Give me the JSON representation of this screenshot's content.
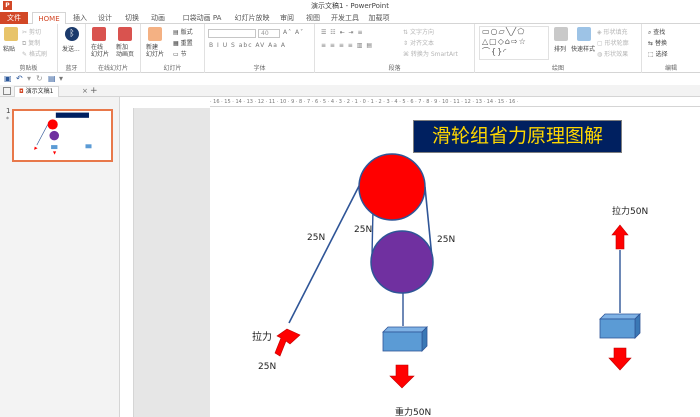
{
  "window": {
    "title": "演示文稿1 - PowerPoint",
    "app_logo": "P"
  },
  "tabs": [
    {
      "label": "文件"
    },
    {
      "label": "HOME"
    },
    {
      "label": "插入"
    },
    {
      "label": "设计"
    },
    {
      "label": "切换"
    },
    {
      "label": "动画"
    },
    {
      "label": "口袋动画 PA"
    },
    {
      "label": "幻灯片放映"
    },
    {
      "label": "审阅"
    },
    {
      "label": "视图"
    },
    {
      "label": "开发工具"
    },
    {
      "label": "加载项"
    }
  ],
  "ribbon": {
    "clipboard": {
      "paste": "粘贴",
      "cut": "剪切",
      "copy": "复制",
      "format_painter": "格式刷",
      "group_label": "剪贴板"
    },
    "bluetooth": {
      "send": "发送...",
      "group_label": "蓝牙"
    },
    "online": {
      "present_online": "在线\n幻灯片",
      "new_slide_from": "新加\n动画页",
      "group_label": "在线幻灯片"
    },
    "slides": {
      "new_slide": "新建\n幻灯片",
      "layout": "版式",
      "reset": "重置",
      "section": "节",
      "group_label": "幻灯片"
    },
    "font": {
      "font_name": "",
      "font_size": "40",
      "group_label": "字体"
    },
    "paragraph": {
      "text_direction": "文字方向",
      "align_text": "对齐文本",
      "convert_smartart": "转换为 SmartArt",
      "group_label": "段落"
    },
    "drawing": {
      "arrange": "排列",
      "quick_styles": "快速样式",
      "shape_fill": "形状填充",
      "shape_outline": "形状轮廓",
      "shape_effects": "形状效果",
      "group_label": "绘图"
    },
    "editing": {
      "find": "查找",
      "replace": "替换",
      "select": "选择",
      "group_label": "编辑"
    }
  },
  "doc_tab": {
    "name": "演示文稿1",
    "close": "×",
    "add": "+"
  },
  "thumbnails": [
    {
      "number": "1",
      "star": "*"
    }
  ],
  "ruler": {
    "top_marks": "· 16 · 15 · 14 · 13 · 12 · 11 · 10 · 9 · 8 · 7 · 6 · 5 · 4 · 3 · 2 · 1 · 0 · 1 · 2 · 3 · 4 · 5 · 6 · 7 · 8 · 9 · 10 · 11 · 12 · 13 · 14 · 15 · 16 ·"
  },
  "slide": {
    "title": "滑轮组省力原理图解",
    "labels": {
      "rope_left": "25N",
      "rope_mid": "25N",
      "rope_right": "25N",
      "pull": "拉力",
      "pull_value": "25N",
      "gravity": "重力50N",
      "pull_50": "拉力50N"
    }
  },
  "colors": {
    "accent": "#d24726",
    "title_bg": "#002060",
    "title_text": "#ffd700",
    "pulley_top": "#ff0000",
    "pulley_bottom": "#7030a0",
    "box": "#5b9bd5",
    "rope": "#2f5597"
  }
}
